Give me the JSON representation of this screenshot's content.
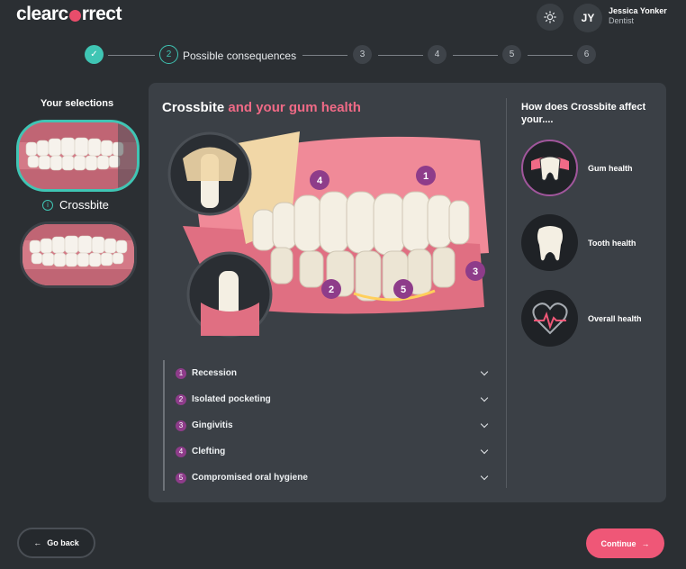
{
  "header": {
    "logo_text_left": "clearc",
    "logo_text_right": "rrect",
    "user_initials": "JY",
    "user_name": "Jessica Yonker",
    "user_role": "Dentist"
  },
  "stepper": {
    "steps": [
      {
        "label": "",
        "num": "✓",
        "state": "done"
      },
      {
        "label": "Possible consequences",
        "num": "2",
        "state": "active"
      },
      {
        "label": "",
        "num": "3",
        "state": "pending"
      },
      {
        "label": "",
        "num": "4",
        "state": "pending"
      },
      {
        "label": "",
        "num": "5",
        "state": "pending"
      },
      {
        "label": "",
        "num": "6",
        "state": "pending"
      }
    ]
  },
  "selections": {
    "title": "Your selections",
    "active_label": "Crossbite",
    "info_glyph": "i"
  },
  "main": {
    "title_white": "Crossbite",
    "title_pink": " and your gum health",
    "markers": [
      "1",
      "2",
      "3",
      "4",
      "5"
    ],
    "consequences": [
      {
        "num": "1",
        "label": "Recession"
      },
      {
        "num": "2",
        "label": "Isolated pocketing"
      },
      {
        "num": "3",
        "label": "Gingivitis"
      },
      {
        "num": "4",
        "label": "Clefting"
      },
      {
        "num": "5",
        "label": "Compromised oral hygiene"
      }
    ]
  },
  "side": {
    "title": "How does Crossbite affect your....",
    "items": [
      {
        "label": "Gum health",
        "icon": "gum-health-icon",
        "active": true
      },
      {
        "label": "Tooth health",
        "icon": "tooth-health-icon",
        "active": false
      },
      {
        "label": "Overall health",
        "icon": "heart-health-icon",
        "active": false
      }
    ]
  },
  "footer": {
    "back_label": "Go back",
    "back_arrow": "←",
    "continue_label": "Continue",
    "continue_arrow": "→"
  },
  "colors": {
    "accent_teal": "#3fc5b4",
    "accent_pink": "#ef5777",
    "marker_purple": "#8e3c8a",
    "background": "#2b2f33",
    "panel": "#3b4046"
  }
}
